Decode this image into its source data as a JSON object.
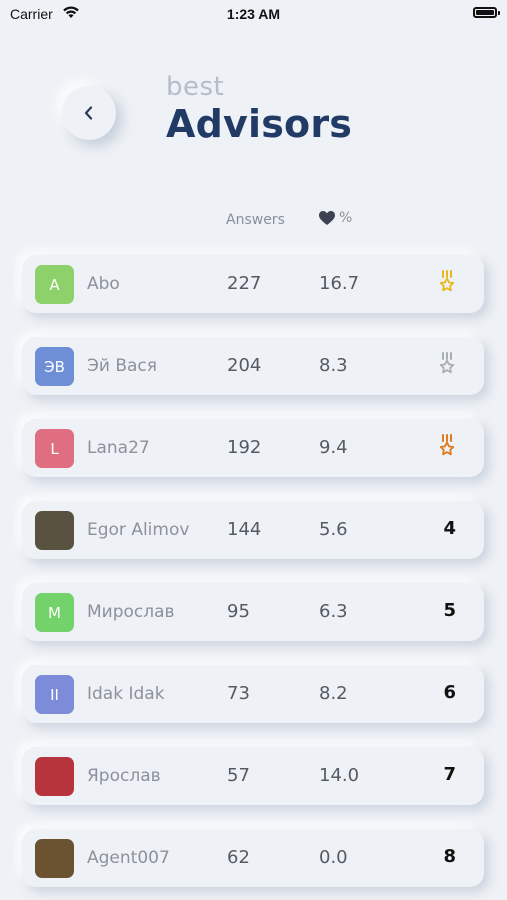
{
  "status": {
    "carrier": "Carrier",
    "time": "1:23 AM"
  },
  "header": {
    "title_top": "best",
    "title_main": "Advisors"
  },
  "columns": {
    "answers": "Answers",
    "likes_suffix": "%"
  },
  "colors": {
    "gold": "#e8b91c",
    "silver": "#a8adb7",
    "bronze": "#e07b1c",
    "heart": "#3d4352"
  },
  "advisors": [
    {
      "avatar_text": "A",
      "avatar_color": "#8dd16b",
      "name": "Abo",
      "answers": "227",
      "likes": "16.7",
      "medal": "gold"
    },
    {
      "avatar_text": "ЭВ",
      "avatar_color": "#6e8fd6",
      "name": "Эй Вася",
      "answers": "204",
      "likes": "8.3",
      "medal": "silver"
    },
    {
      "avatar_text": "L",
      "avatar_color": "#df6f80",
      "name": "Lana27",
      "answers": "192",
      "likes": "9.4",
      "medal": "bronze"
    },
    {
      "avatar_text": "",
      "avatar_color": "#5a5240",
      "name": "Egor Alimov",
      "answers": "144",
      "likes": "5.6",
      "rank": "4"
    },
    {
      "avatar_text": "M",
      "avatar_color": "#74d26a",
      "name": "Мирослав",
      "answers": "95",
      "likes": "6.3",
      "rank": "5"
    },
    {
      "avatar_text": "II",
      "avatar_color": "#7d8cd9",
      "name": "Idak Idak",
      "answers": "73",
      "likes": "8.2",
      "rank": "6"
    },
    {
      "avatar_text": "",
      "avatar_color": "#b8343c",
      "name": "Ярослав",
      "answers": "57",
      "likes": "14.0",
      "rank": "7"
    },
    {
      "avatar_text": "",
      "avatar_color": "#6b5230",
      "name": "Agent007",
      "answers": "62",
      "likes": "0.0",
      "rank": "8"
    }
  ]
}
